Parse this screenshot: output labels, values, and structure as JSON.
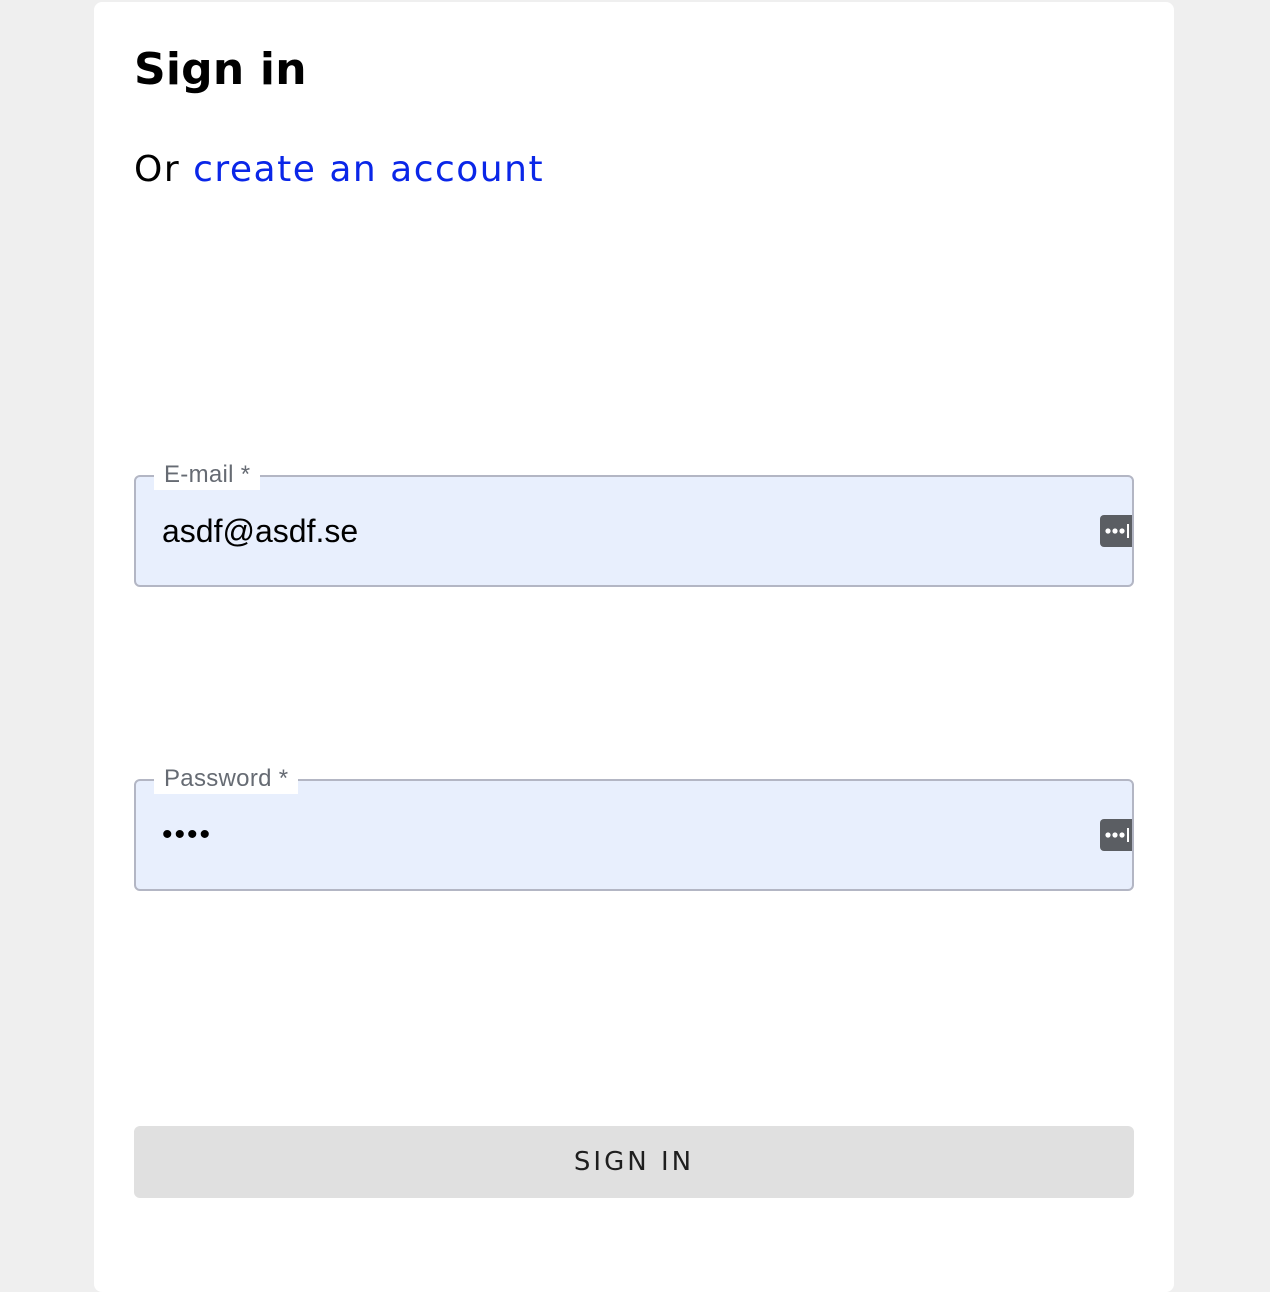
{
  "page": {
    "title": "Sign in",
    "subtitle_prefix": "Or",
    "create_account_link": "create an account"
  },
  "form": {
    "email": {
      "label": "E-mail *",
      "value": "asdf@asdf.se"
    },
    "password": {
      "label": "Password *",
      "value": "asdf"
    },
    "submit_label": "SIGN IN"
  },
  "icons": {
    "password_manager": "password-manager-icon"
  },
  "colors": {
    "link": "#0a26e8",
    "autofill_background": "#e8effd",
    "button_background": "#e0e0e0"
  }
}
